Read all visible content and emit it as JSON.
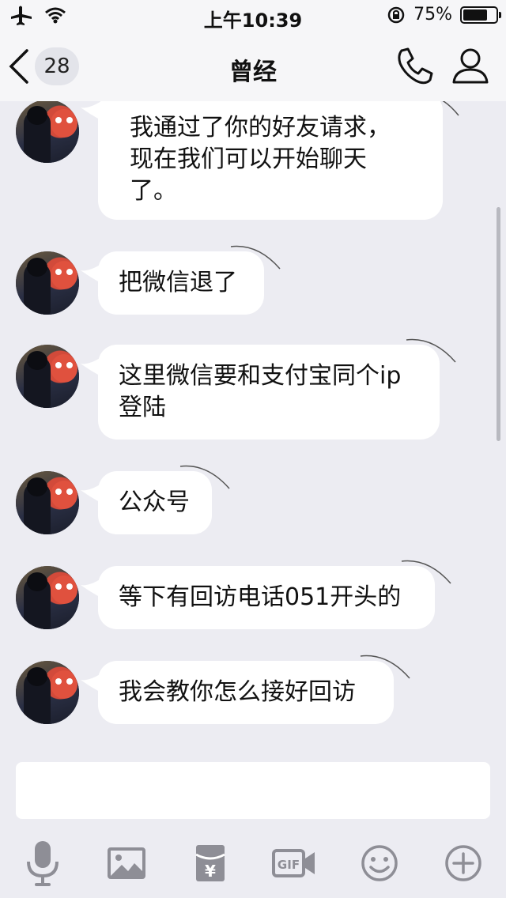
{
  "status_bar": {
    "time": "上午10:39",
    "battery_text": "75%",
    "battery_level": 0.75
  },
  "nav": {
    "unread_count": "28",
    "title": "曾经"
  },
  "messages": [
    {
      "text": "我通过了你的好友请求，\n现在我们可以开始聊天\n了。"
    },
    {
      "text": "把微信退了"
    },
    {
      "text": "这里微信要和支付宝同个ip\n登陆"
    },
    {
      "text": "公众号"
    },
    {
      "text": "等下有回访电话051开头的"
    },
    {
      "text": "我会教你怎么接好回访"
    }
  ],
  "input": {
    "value": ""
  },
  "toolbar": {
    "icons": [
      "microphone-icon",
      "image-icon",
      "red-packet-icon",
      "gif-icon",
      "emoji-icon",
      "plus-icon"
    ],
    "gif_label": "GIF",
    "yen_label": "¥"
  },
  "colors": {
    "background": "#ececf2",
    "bubble": "#ffffff",
    "icon_gray": "#8e8e96"
  }
}
